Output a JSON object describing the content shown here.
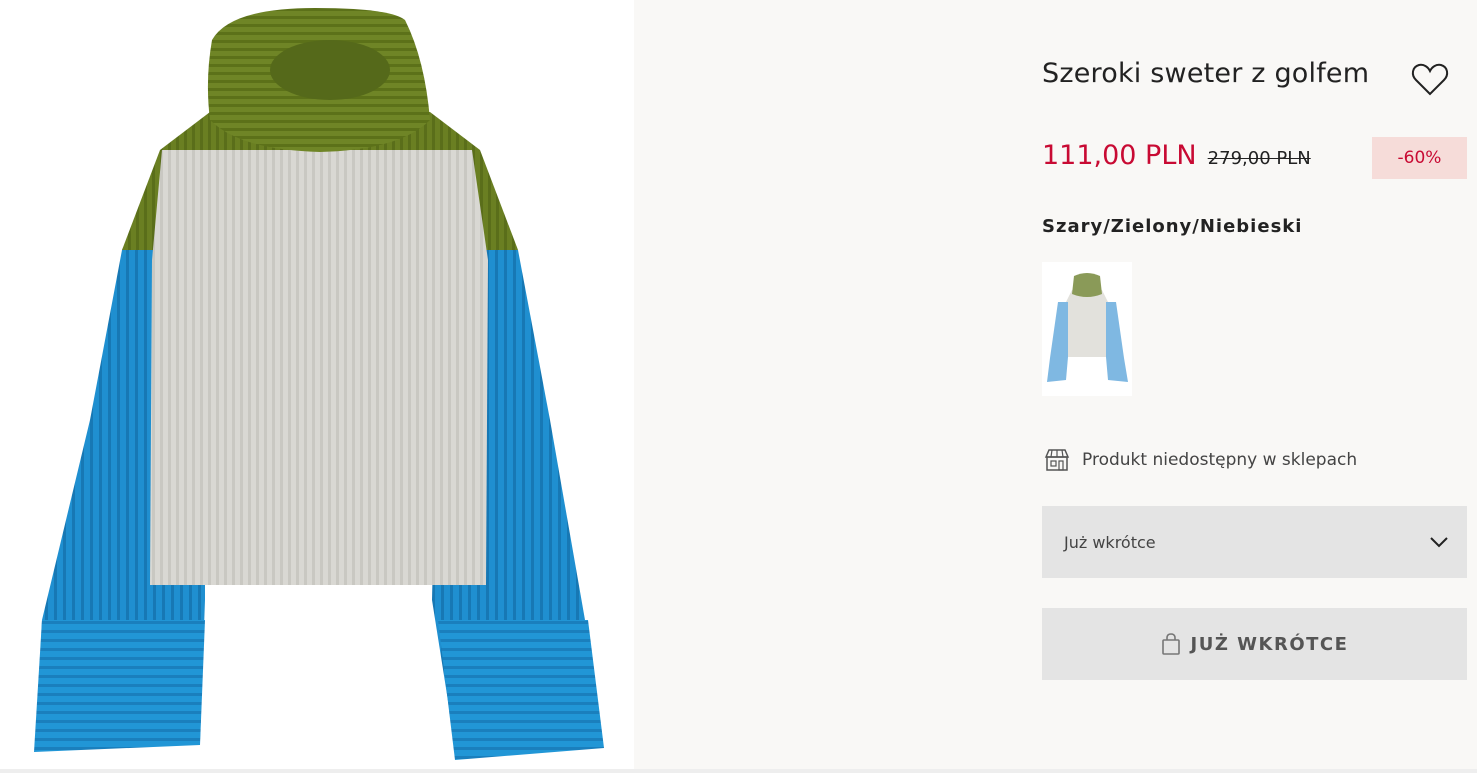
{
  "product": {
    "title": "Szeroki sweter z golfem",
    "price_sale": "111,00 PLN",
    "price_original": "279,00 PLN",
    "discount": "-60%",
    "color_name": "Szary/Zielony/Niebieski"
  },
  "availability": {
    "store_text": "Produkt niedostępny w sklepach"
  },
  "size_select": {
    "selected": "Już wkrótce"
  },
  "add_button": {
    "label": "JUŻ WKRÓTCE"
  },
  "icons": {
    "favorite": "heart-icon",
    "store": "store-icon",
    "dropdown": "chevron-down-icon",
    "bag": "shopping-bag-icon"
  },
  "colors": {
    "sale_red": "#c80a33",
    "badge_bg": "#f6dcd9",
    "sweater_green": "#6a7f22",
    "sweater_grey": "#d9d8d3",
    "sweater_blue": "#1f8fd0",
    "button_bg": "#e4e4e4"
  }
}
